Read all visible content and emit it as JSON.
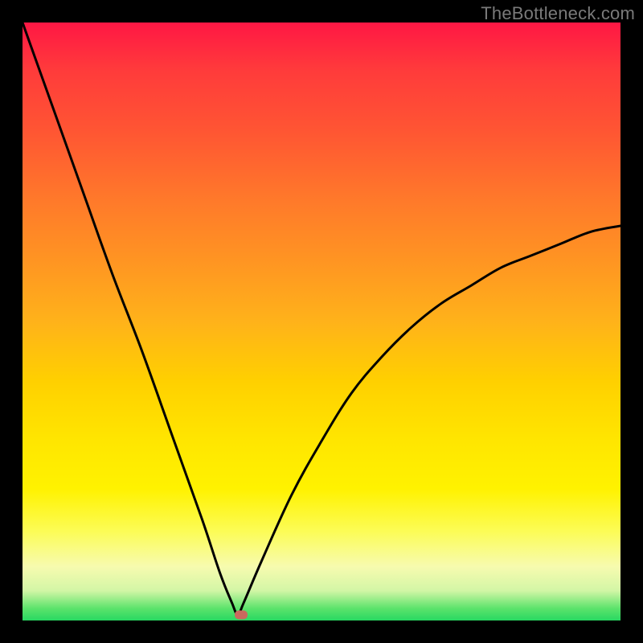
{
  "watermark": "TheBottleneck.com",
  "chart_data": {
    "type": "line",
    "title": "",
    "xlabel": "",
    "ylabel": "",
    "xlim": [
      0,
      100
    ],
    "ylim": [
      0,
      100
    ],
    "grid": false,
    "legend": false,
    "description": "V-shaped bottleneck curve on rainbow gradient background. Curve descends from top-left, reaches minimum near x≈36, then rises with diminishing slope to the right edge at ≈66% height.",
    "series": [
      {
        "name": "bottleneck-curve",
        "x": [
          0,
          5,
          10,
          15,
          20,
          25,
          30,
          33,
          35,
          36,
          37,
          40,
          45,
          50,
          55,
          60,
          65,
          70,
          75,
          80,
          85,
          90,
          95,
          100
        ],
        "y": [
          100,
          86,
          72,
          58,
          45,
          31,
          17,
          8,
          3,
          1,
          3,
          10,
          21,
          30,
          38,
          44,
          49,
          53,
          56,
          59,
          61,
          63,
          65,
          66
        ]
      }
    ],
    "marker": {
      "x": 36.5,
      "y": 1.0,
      "color": "#c9695e"
    },
    "gradient_stops": [
      {
        "pos": 0,
        "color": "#ff1744"
      },
      {
        "pos": 50,
        "color": "#ffd000"
      },
      {
        "pos": 85,
        "color": "#fcfc55"
      },
      {
        "pos": 100,
        "color": "#28d862"
      }
    ]
  }
}
